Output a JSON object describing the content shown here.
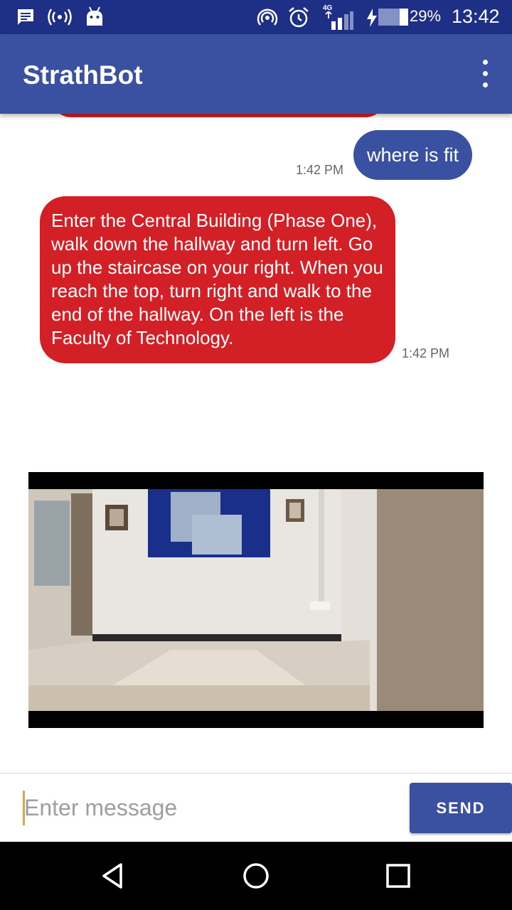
{
  "status_bar": {
    "battery": "29%",
    "time": "13:42",
    "network": "4G",
    "icons": [
      "message-icon",
      "hotspot-icon",
      "android-icon",
      "cast-icon",
      "alarm-icon",
      "signal-icon",
      "charging-icon",
      "battery-icon"
    ]
  },
  "app_bar": {
    "title": "StrathBot",
    "menu_icon": "more-vert-icon"
  },
  "chat": {
    "messages": [
      {
        "sender": "user",
        "text": "where is fit",
        "time": "1:42 PM"
      },
      {
        "sender": "bot",
        "text": "Enter the Central Building (Phase One), walk down the hallway and turn left. Go up the staircase on your right. When you reach the top, turn right and walk to the end of the hallway. On the left is the Faculty of Technology.",
        "time": "1:42 PM"
      }
    ]
  },
  "input": {
    "placeholder": "Enter message",
    "value": "",
    "send_label": "SEND"
  },
  "colors": {
    "status_bar": "#1e2f86",
    "primary": "#3a50a0",
    "bot_bubble": "#d32027",
    "cursor": "#d4a84b"
  },
  "nav_bar": {
    "icons": [
      "back-icon",
      "home-icon",
      "recents-icon"
    ]
  }
}
